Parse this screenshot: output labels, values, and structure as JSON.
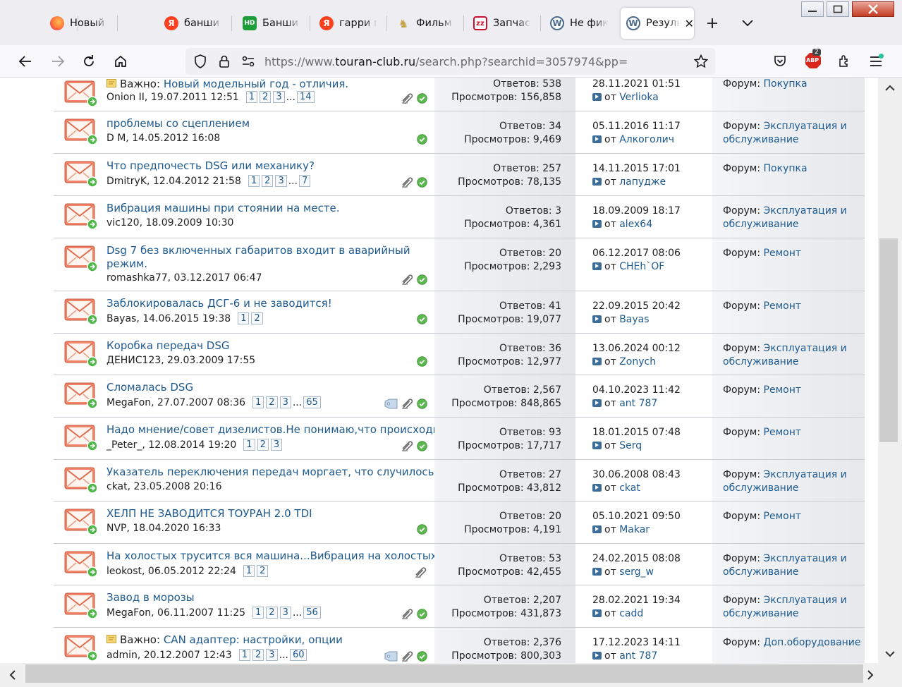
{
  "browser": {
    "tabs": [
      {
        "title": "Новый пр",
        "icon": "firefox-icon",
        "color": "#e66000"
      },
      {
        "title": "банши с",
        "icon": "yandex-icon",
        "color": "#fc3f1d"
      },
      {
        "title": "Банши с",
        "icon": "hd-icon",
        "color": "#1e9e3a"
      },
      {
        "title": "гарри по",
        "icon": "yandex-icon",
        "color": "#fc3f1d"
      },
      {
        "title": "Фильм Г",
        "icon": "film-icon",
        "color": "#c7a34a"
      },
      {
        "title": "Запчасти",
        "icon": "zz-icon",
        "color": "#c8102e"
      },
      {
        "title": "Не фикс",
        "icon": "vw-icon",
        "color": "#4a6a8e"
      },
      {
        "title": "Резуль",
        "icon": "vw-icon",
        "color": "#4a6a8e"
      }
    ],
    "url_prefix": "https://www.",
    "url_host": "touran-club.ru",
    "url_rest": "/search.php?searchid=3057974&pp=",
    "badge": "2",
    "abp": "ABP"
  },
  "labels": {
    "replies": "Ответов:",
    "views": "Просмотров:",
    "by": "от",
    "forum": "Форум:",
    "important": "Важно:"
  },
  "threads": [
    {
      "important": true,
      "title": "Новый модельный год - отличия.",
      "author": "Onion II, 19.07.2011 12:51",
      "pages": [
        "1",
        "2",
        "3",
        "14"
      ],
      "attach": true,
      "tag": false,
      "check": true,
      "replies": "538",
      "views": "156,858",
      "date": "28.11.2021 01:51",
      "last": "Verlioka",
      "forum1": "Покупка",
      "forum2": ""
    },
    {
      "important": false,
      "title": "проблемы со сцеплением",
      "author": "D M, 14.05.2012 16:08",
      "pages": [],
      "attach": false,
      "tag": false,
      "check": true,
      "replies": "34",
      "views": "9,469",
      "date": "05.11.2016 11:17",
      "last": "Алкоголич",
      "forum1": "Эксплуатация и",
      "forum2": "обслуживание"
    },
    {
      "important": false,
      "title": "Что предпочесть DSG или механику?",
      "author": "DmitryK, 12.04.2012 21:58",
      "pages": [
        "1",
        "2",
        "3",
        "7"
      ],
      "attach": true,
      "tag": false,
      "check": true,
      "replies": "257",
      "views": "78,135",
      "date": "14.11.2015 17:01",
      "last": "лапудже",
      "forum1": "Покупка",
      "forum2": ""
    },
    {
      "important": false,
      "title": "Вибрация машины при стоянии на месте.",
      "author": "vic120, 18.09.2009 10:30",
      "pages": [],
      "attach": false,
      "tag": false,
      "check": false,
      "replies": "3",
      "views": "4,361",
      "date": "18.09.2009 18:17",
      "last": "alex64",
      "forum1": "Эксплуатация и",
      "forum2": "обслуживание"
    },
    {
      "important": false,
      "title": "Dsg 7 без включенных габаритов входит в аварийный",
      "title2": "режим.",
      "author": "romashka77, 03.12.2017 06:47",
      "pages": [],
      "attach": true,
      "tag": false,
      "check": true,
      "replies": "20",
      "views": "2,293",
      "date": "06.12.2017 08:06",
      "last": "CHEh`OF",
      "forum1": "Ремонт",
      "forum2": ""
    },
    {
      "important": false,
      "title": "Заблокировалась ДСГ-6 и не заводится!",
      "author": "Bayas, 14.06.2015 19:38",
      "pages": [
        "1",
        "2"
      ],
      "attach": false,
      "tag": false,
      "check": true,
      "replies": "41",
      "views": "19,077",
      "date": "22.09.2015 20:42",
      "last": "Bayas",
      "forum1": "Ремонт",
      "forum2": ""
    },
    {
      "important": false,
      "title": "Коробка передач DSG",
      "author": "ДЕНИС123, 29.03.2009 17:55",
      "pages": [],
      "attach": false,
      "tag": false,
      "check": true,
      "replies": "36",
      "views": "12,977",
      "date": "13.06.2024 00:12",
      "last": "Zonych",
      "forum1": "Эксплуатация и",
      "forum2": "обслуживание"
    },
    {
      "important": false,
      "title": "Сломалась DSG",
      "author": "MegaFon, 27.07.2007 08:36",
      "pages": [
        "1",
        "2",
        "3",
        "65"
      ],
      "attach": true,
      "tag": true,
      "check": true,
      "replies": "2,567",
      "views": "848,865",
      "date": "04.10.2023 11:42",
      "last": "ant 787",
      "forum1": "Ремонт",
      "forum2": ""
    },
    {
      "important": false,
      "title": "Надо мнение/совет дизелистов.Не понимаю,что происходит",
      "author": "_Peter_, 12.08.2014 19:20",
      "pages": [
        "1",
        "2",
        "3"
      ],
      "attach": true,
      "tag": false,
      "check": true,
      "replies": "93",
      "views": "17,717",
      "date": "18.01.2015 07:48",
      "last": "Serq",
      "forum1": "Ремонт",
      "forum2": ""
    },
    {
      "important": false,
      "title": "Указатель переключения передач моргает, что случилось?",
      "author": "ckat, 23.05.2008 20:16",
      "pages": [],
      "attach": false,
      "tag": false,
      "check": false,
      "replies": "27",
      "views": "43,812",
      "date": "30.06.2008 08:43",
      "last": "ckat",
      "forum1": "Эксплуатация и",
      "forum2": "обслуживание"
    },
    {
      "important": false,
      "title": "ХЕЛП НЕ ЗАВОДИТСЯ ТОУРАН 2.0 TDI",
      "author": "NVP, 18.04.2020 16:33",
      "pages": [],
      "attach": false,
      "tag": false,
      "check": true,
      "replies": "20",
      "views": "4,191",
      "date": "05.10.2021 09:50",
      "last": "Makar",
      "forum1": "Ремонт",
      "forum2": ""
    },
    {
      "important": false,
      "title": "На холостых трусится вся машина...Вибрация на холостых",
      "author": "leokost, 06.05.2012 22:24",
      "pages": [
        "1",
        "2"
      ],
      "attach": true,
      "tag": false,
      "check": false,
      "replies": "53",
      "views": "42,455",
      "date": "24.02.2015 08:08",
      "last": "serg_w",
      "forum1": "Эксплуатация и",
      "forum2": "обслуживание"
    },
    {
      "important": false,
      "title": "Завод в морозы",
      "author": "MegaFon, 06.11.2007 11:25",
      "pages": [
        "1",
        "2",
        "3",
        "56"
      ],
      "attach": true,
      "tag": false,
      "check": true,
      "replies": "2,207",
      "views": "431,873",
      "date": "28.02.2021 19:34",
      "last": "cadd",
      "forum1": "Эксплуатация и",
      "forum2": "обслуживание"
    },
    {
      "important": true,
      "title": "CAN адаптер: настройки, опции",
      "author": "admin, 20.12.2007 12:43",
      "pages": [
        "1",
        "2",
        "3",
        "60"
      ],
      "attach": true,
      "tag": true,
      "check": true,
      "replies": "2,376",
      "views": "800,303",
      "date": "17.12.2023 14:11",
      "last": "ant 787",
      "forum1": "Доп.оборудование",
      "forum2": ""
    }
  ]
}
